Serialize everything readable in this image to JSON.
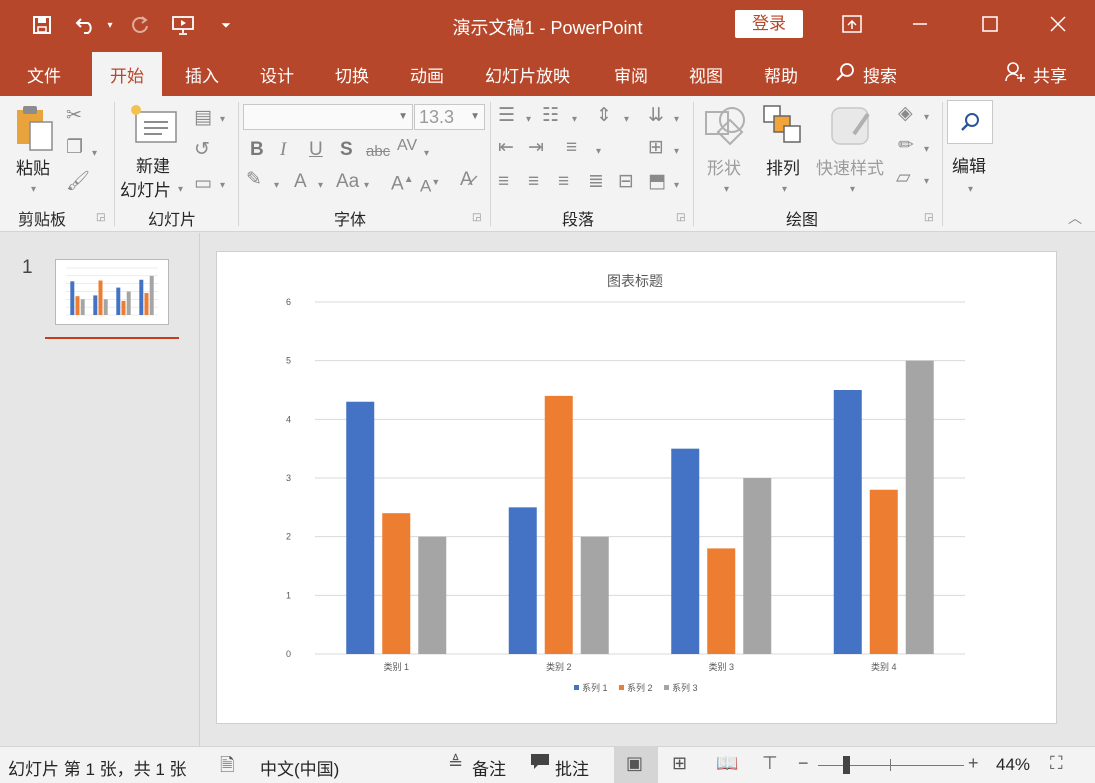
{
  "window": {
    "title": "演示文稿1  -  PowerPoint",
    "login_label": "登录"
  },
  "menu": {
    "tabs": [
      "文件",
      "开始",
      "插入",
      "设计",
      "切换",
      "动画",
      "幻灯片放映",
      "审阅",
      "视图",
      "帮助"
    ],
    "active_tab": "开始",
    "search_label": "搜索",
    "share_label": "共享"
  },
  "ribbon": {
    "clipboard": {
      "paste": "粘贴",
      "group": "剪贴板"
    },
    "slides": {
      "new_slide_line1": "新建",
      "new_slide_line2": "幻灯片",
      "group": "幻灯片"
    },
    "font": {
      "font_name": "",
      "font_size": "13.3",
      "group": "字体"
    },
    "paragraph": {
      "group": "段落"
    },
    "drawing": {
      "shapes": "形状",
      "arrange": "排列",
      "quick_styles": "快速样式",
      "group": "绘图"
    },
    "editing": {
      "label": "编辑"
    }
  },
  "slide_pane": {
    "slide_number": "1"
  },
  "chart_data": {
    "type": "bar",
    "title": "图表标题",
    "categories": [
      "类别 1",
      "类别 2",
      "类别 3",
      "类别 4"
    ],
    "series": [
      {
        "name": "系列 1",
        "color": "#4472c4",
        "values": [
          4.3,
          2.5,
          3.5,
          4.5
        ]
      },
      {
        "name": "系列 2",
        "color": "#ed7d31",
        "values": [
          2.4,
          4.4,
          1.8,
          2.8
        ]
      },
      {
        "name": "系列 3",
        "color": "#a5a5a5",
        "values": [
          2.0,
          2.0,
          3.0,
          5.0
        ]
      }
    ],
    "ylim": [
      0,
      6
    ],
    "yticks": [
      "0",
      "1",
      "2",
      "3",
      "4",
      "5",
      "6"
    ],
    "grid": true,
    "legend_position": "bottom"
  },
  "status": {
    "slide_info": "幻灯片 第 1 张，共 1 张",
    "language": "中文(中国)",
    "notes": "备注",
    "comments": "批注",
    "zoom": "44%"
  }
}
